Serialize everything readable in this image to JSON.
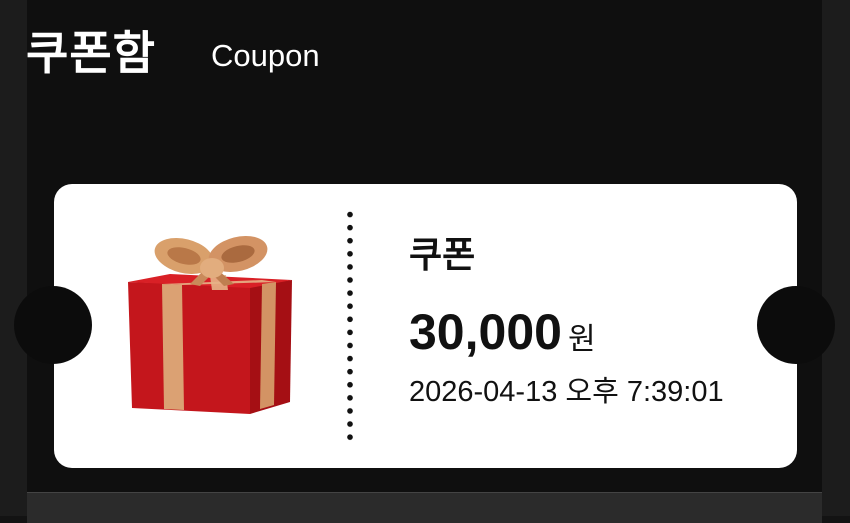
{
  "header": {
    "title": "쿠폰함",
    "subtitle": "Coupon"
  },
  "coupon": {
    "name": "쿠폰",
    "amount": "30,000",
    "unit": "원",
    "datetime": "2026-04-13 오후 7:39:01",
    "image": "gift-box-icon"
  },
  "colors": {
    "background": "#0f0f0f",
    "card": "#ffffff",
    "text": "#111111",
    "gift_red": "#c4161c",
    "ribbon_gold": "#d9a06b"
  }
}
